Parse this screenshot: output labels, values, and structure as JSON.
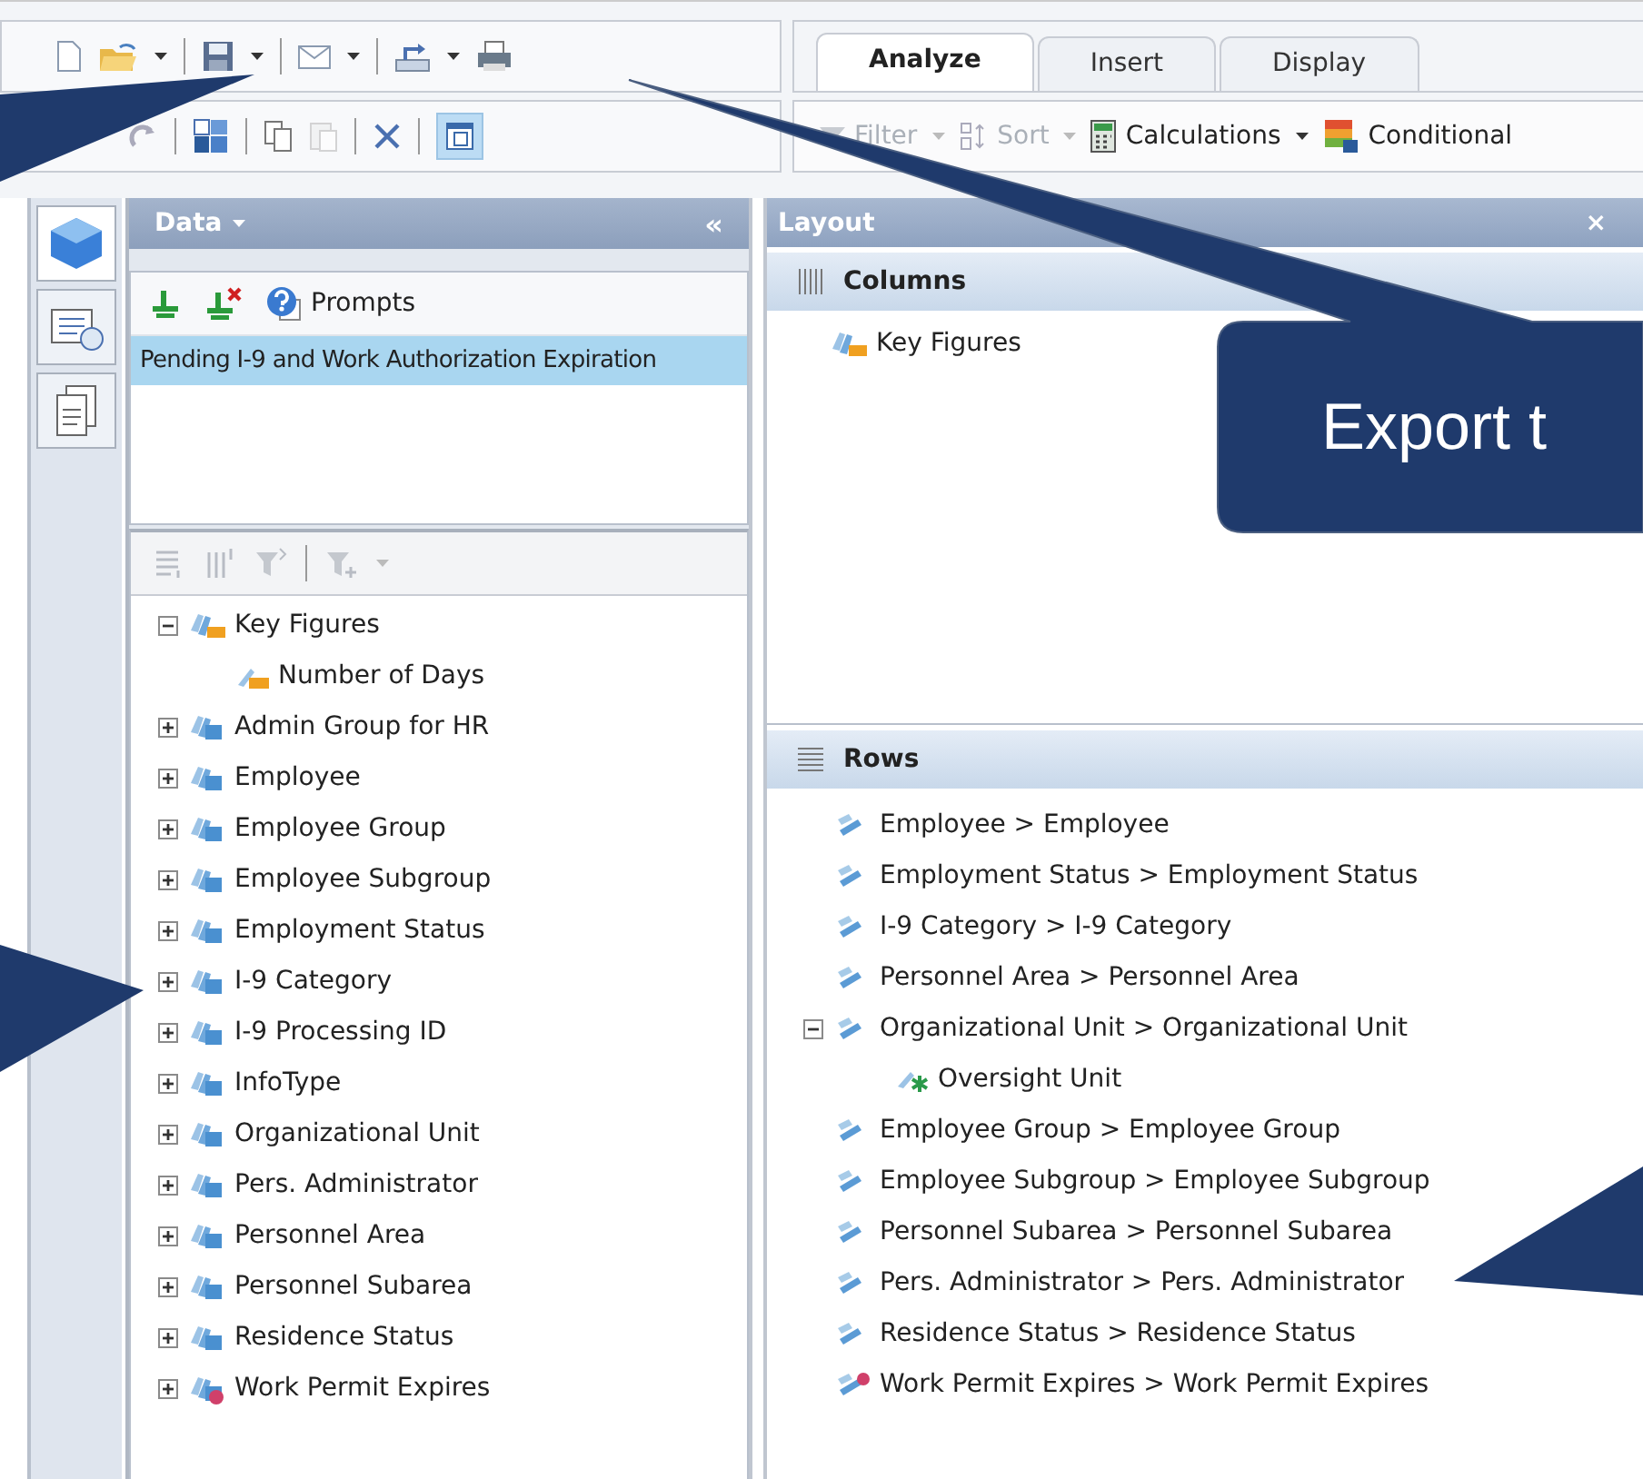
{
  "ribbon": {
    "tabs": [
      {
        "label": "Analyze",
        "selected": true
      },
      {
        "label": "Insert",
        "selected": false
      },
      {
        "label": "Display",
        "selected": false
      }
    ],
    "tools": [
      {
        "label": "Filter",
        "kind": "filter",
        "disabled": true
      },
      {
        "label": "Sort",
        "kind": "sort",
        "disabled": true
      },
      {
        "label": "Calculations",
        "kind": "calculations",
        "disabled": false
      },
      {
        "label": "Conditional",
        "kind": "conditional",
        "disabled": false
      }
    ]
  },
  "side_strip": [
    {
      "kind": "data",
      "selected": true
    },
    {
      "kind": "properties",
      "selected": false
    },
    {
      "kind": "documents",
      "selected": false
    }
  ],
  "data_panel": {
    "title": "Data",
    "collapse": "«",
    "prompts": "Prompts",
    "queries": [
      {
        "label": "Pending I-9 and Work Authorization Expiration",
        "selected": true
      }
    ],
    "tree": [
      {
        "label": "Key Figures",
        "kind": "key_figures",
        "expanded": true,
        "children": [
          {
            "label": "Number of Days",
            "kind": "measure"
          }
        ]
      },
      {
        "label": "Admin Group for HR",
        "kind": "dimension",
        "expanded": false
      },
      {
        "label": "Employee",
        "kind": "dimension",
        "expanded": false
      },
      {
        "label": "Employee Group",
        "kind": "dimension",
        "expanded": false
      },
      {
        "label": "Employee Subgroup",
        "kind": "dimension",
        "expanded": false
      },
      {
        "label": "Employment Status",
        "kind": "dimension",
        "expanded": false
      },
      {
        "label": "I-9 Category",
        "kind": "dimension",
        "expanded": false
      },
      {
        "label": "I-9 Processing ID",
        "kind": "dimension",
        "expanded": false
      },
      {
        "label": "InfoType",
        "kind": "dimension",
        "expanded": false
      },
      {
        "label": "Organizational Unit",
        "kind": "dimension",
        "expanded": false
      },
      {
        "label": "Pers. Administrator",
        "kind": "dimension",
        "expanded": false
      },
      {
        "label": "Personnel Area",
        "kind": "dimension",
        "expanded": false
      },
      {
        "label": "Personnel Subarea",
        "kind": "dimension",
        "expanded": false
      },
      {
        "label": "Residence Status",
        "kind": "dimension",
        "expanded": false
      },
      {
        "label": "Work Permit Expires",
        "kind": "time_dimension",
        "expanded": false
      }
    ]
  },
  "layout_panel": {
    "title": "Layout",
    "close": "×",
    "columns": {
      "title": "Columns",
      "items": [
        {
          "label": "Key Figures",
          "kind": "key_figures"
        }
      ]
    },
    "rows": {
      "title": "Rows",
      "items": [
        {
          "label": "Employee > Employee",
          "kind": "hierarchy"
        },
        {
          "label": "Employment Status > Employment Status",
          "kind": "hierarchy"
        },
        {
          "label": "I-9 Category > I-9 Category",
          "kind": "hierarchy"
        },
        {
          "label": "Personnel Area > Personnel Area",
          "kind": "hierarchy"
        },
        {
          "label": "Organizational Unit > Organizational Unit",
          "kind": "hierarchy",
          "expanded": true,
          "children": [
            {
              "label": "Oversight Unit",
              "kind": "attribute"
            }
          ]
        },
        {
          "label": "Employee Group > Employee Group",
          "kind": "hierarchy"
        },
        {
          "label": "Employee Subgroup > Employee Subgroup",
          "kind": "hierarchy"
        },
        {
          "label": "Personnel Subarea > Personnel Subarea",
          "kind": "hierarchy"
        },
        {
          "label": "Pers. Administrator > Pers. Administrator",
          "kind": "hierarchy"
        },
        {
          "label": "Residence Status > Residence Status",
          "kind": "hierarchy"
        },
        {
          "label": "Work Permit Expires > Work Permit Expires",
          "kind": "time_hierarchy"
        }
      ]
    }
  },
  "callouts": [
    {
      "text": "Export t"
    }
  ]
}
